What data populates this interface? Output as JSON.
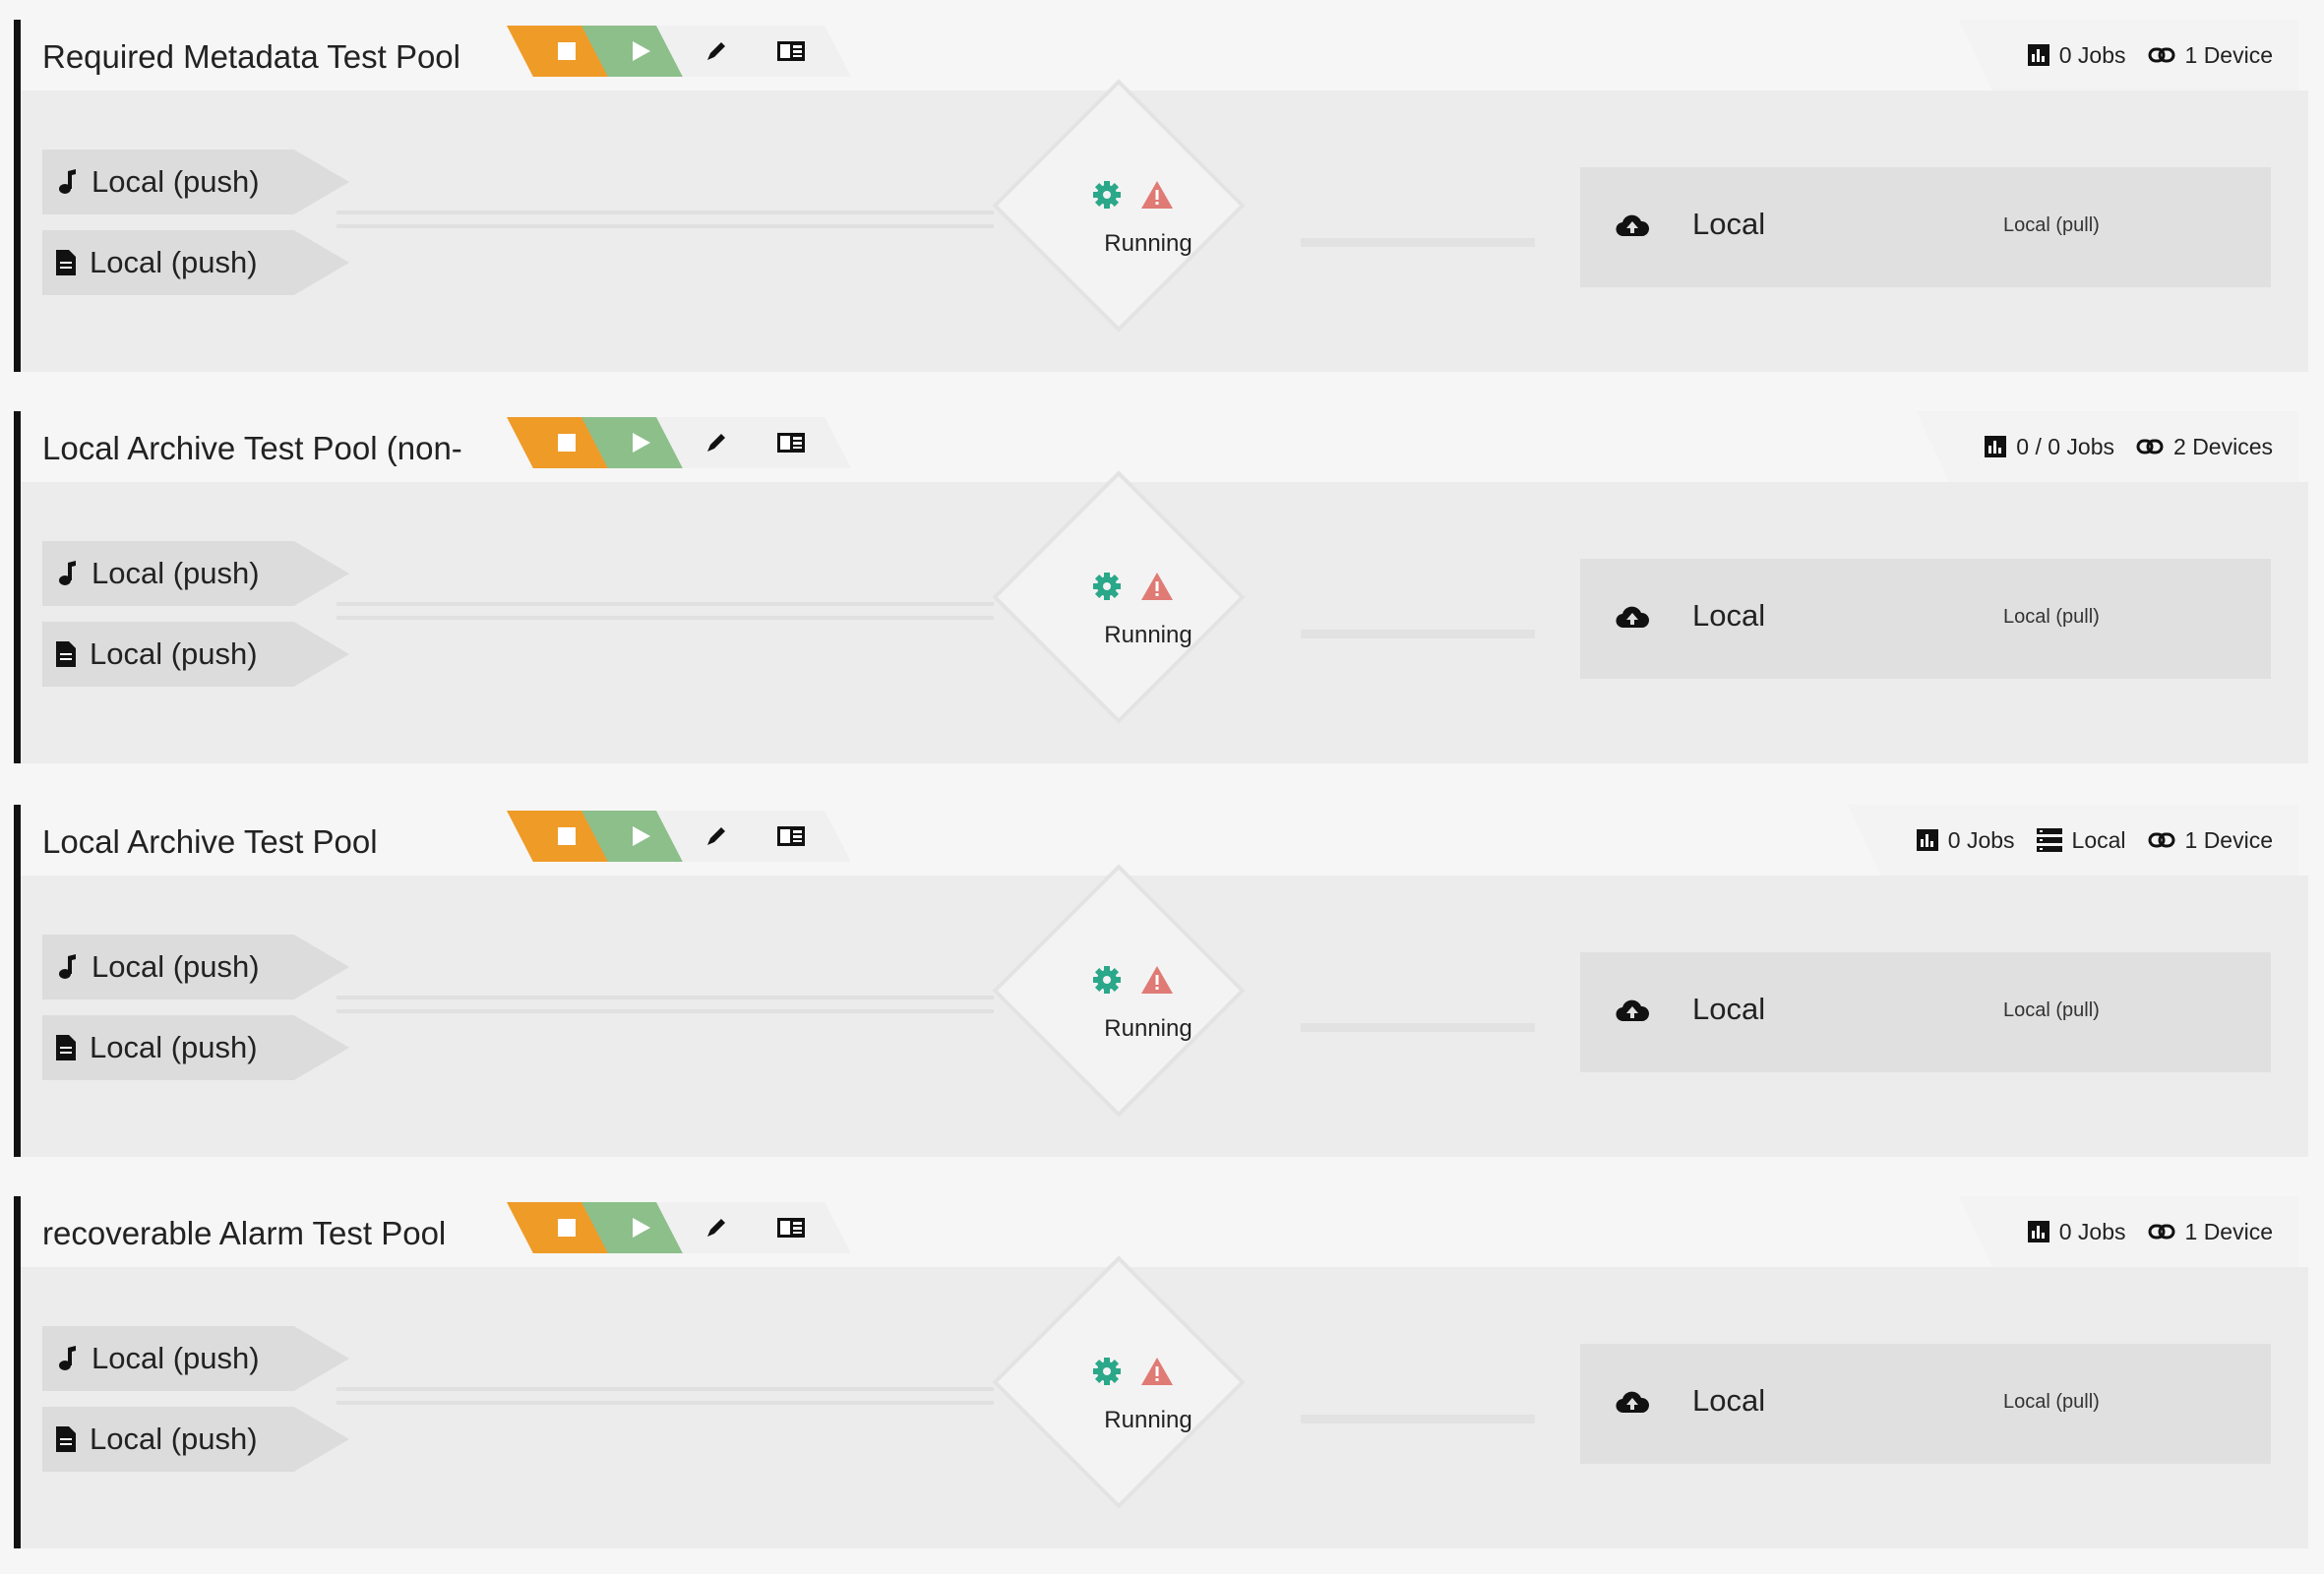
{
  "colors": {
    "stop": "#ef9b28",
    "play": "#8dbf8b",
    "gear": "#2aa889",
    "warning": "#e07a74"
  },
  "pools": [
    {
      "title": "Required Metadata Test Pool",
      "jobs": "0 Jobs",
      "storage": null,
      "devices": "1 Device",
      "sources": [
        {
          "icon": "music-note-icon",
          "label": "Local (push)"
        },
        {
          "icon": "file-icon",
          "label": "Local (push)"
        }
      ],
      "status": "Running",
      "destination": {
        "name": "Local",
        "sub": "Local (pull)"
      }
    },
    {
      "title": "Local Archive Test Pool (non-",
      "jobs": "0 / 0 Jobs",
      "storage": null,
      "devices": "2 Devices",
      "sources": [
        {
          "icon": "music-note-icon",
          "label": "Local (push)"
        },
        {
          "icon": "file-icon",
          "label": "Local (push)"
        }
      ],
      "status": "Running",
      "destination": {
        "name": "Local",
        "sub": "Local (pull)"
      }
    },
    {
      "title": "Local Archive Test Pool",
      "jobs": "0 Jobs",
      "storage": "Local",
      "devices": "1 Device",
      "sources": [
        {
          "icon": "music-note-icon",
          "label": "Local (push)"
        },
        {
          "icon": "file-icon",
          "label": "Local (push)"
        }
      ],
      "status": "Running",
      "destination": {
        "name": "Local",
        "sub": "Local (pull)"
      }
    },
    {
      "title": "recoverable Alarm Test Pool",
      "jobs": "0 Jobs",
      "storage": null,
      "devices": "1 Device",
      "sources": [
        {
          "icon": "music-note-icon",
          "label": "Local (push)"
        },
        {
          "icon": "file-icon",
          "label": "Local (push)"
        }
      ],
      "status": "Running",
      "destination": {
        "name": "Local",
        "sub": "Local (pull)"
      }
    }
  ]
}
